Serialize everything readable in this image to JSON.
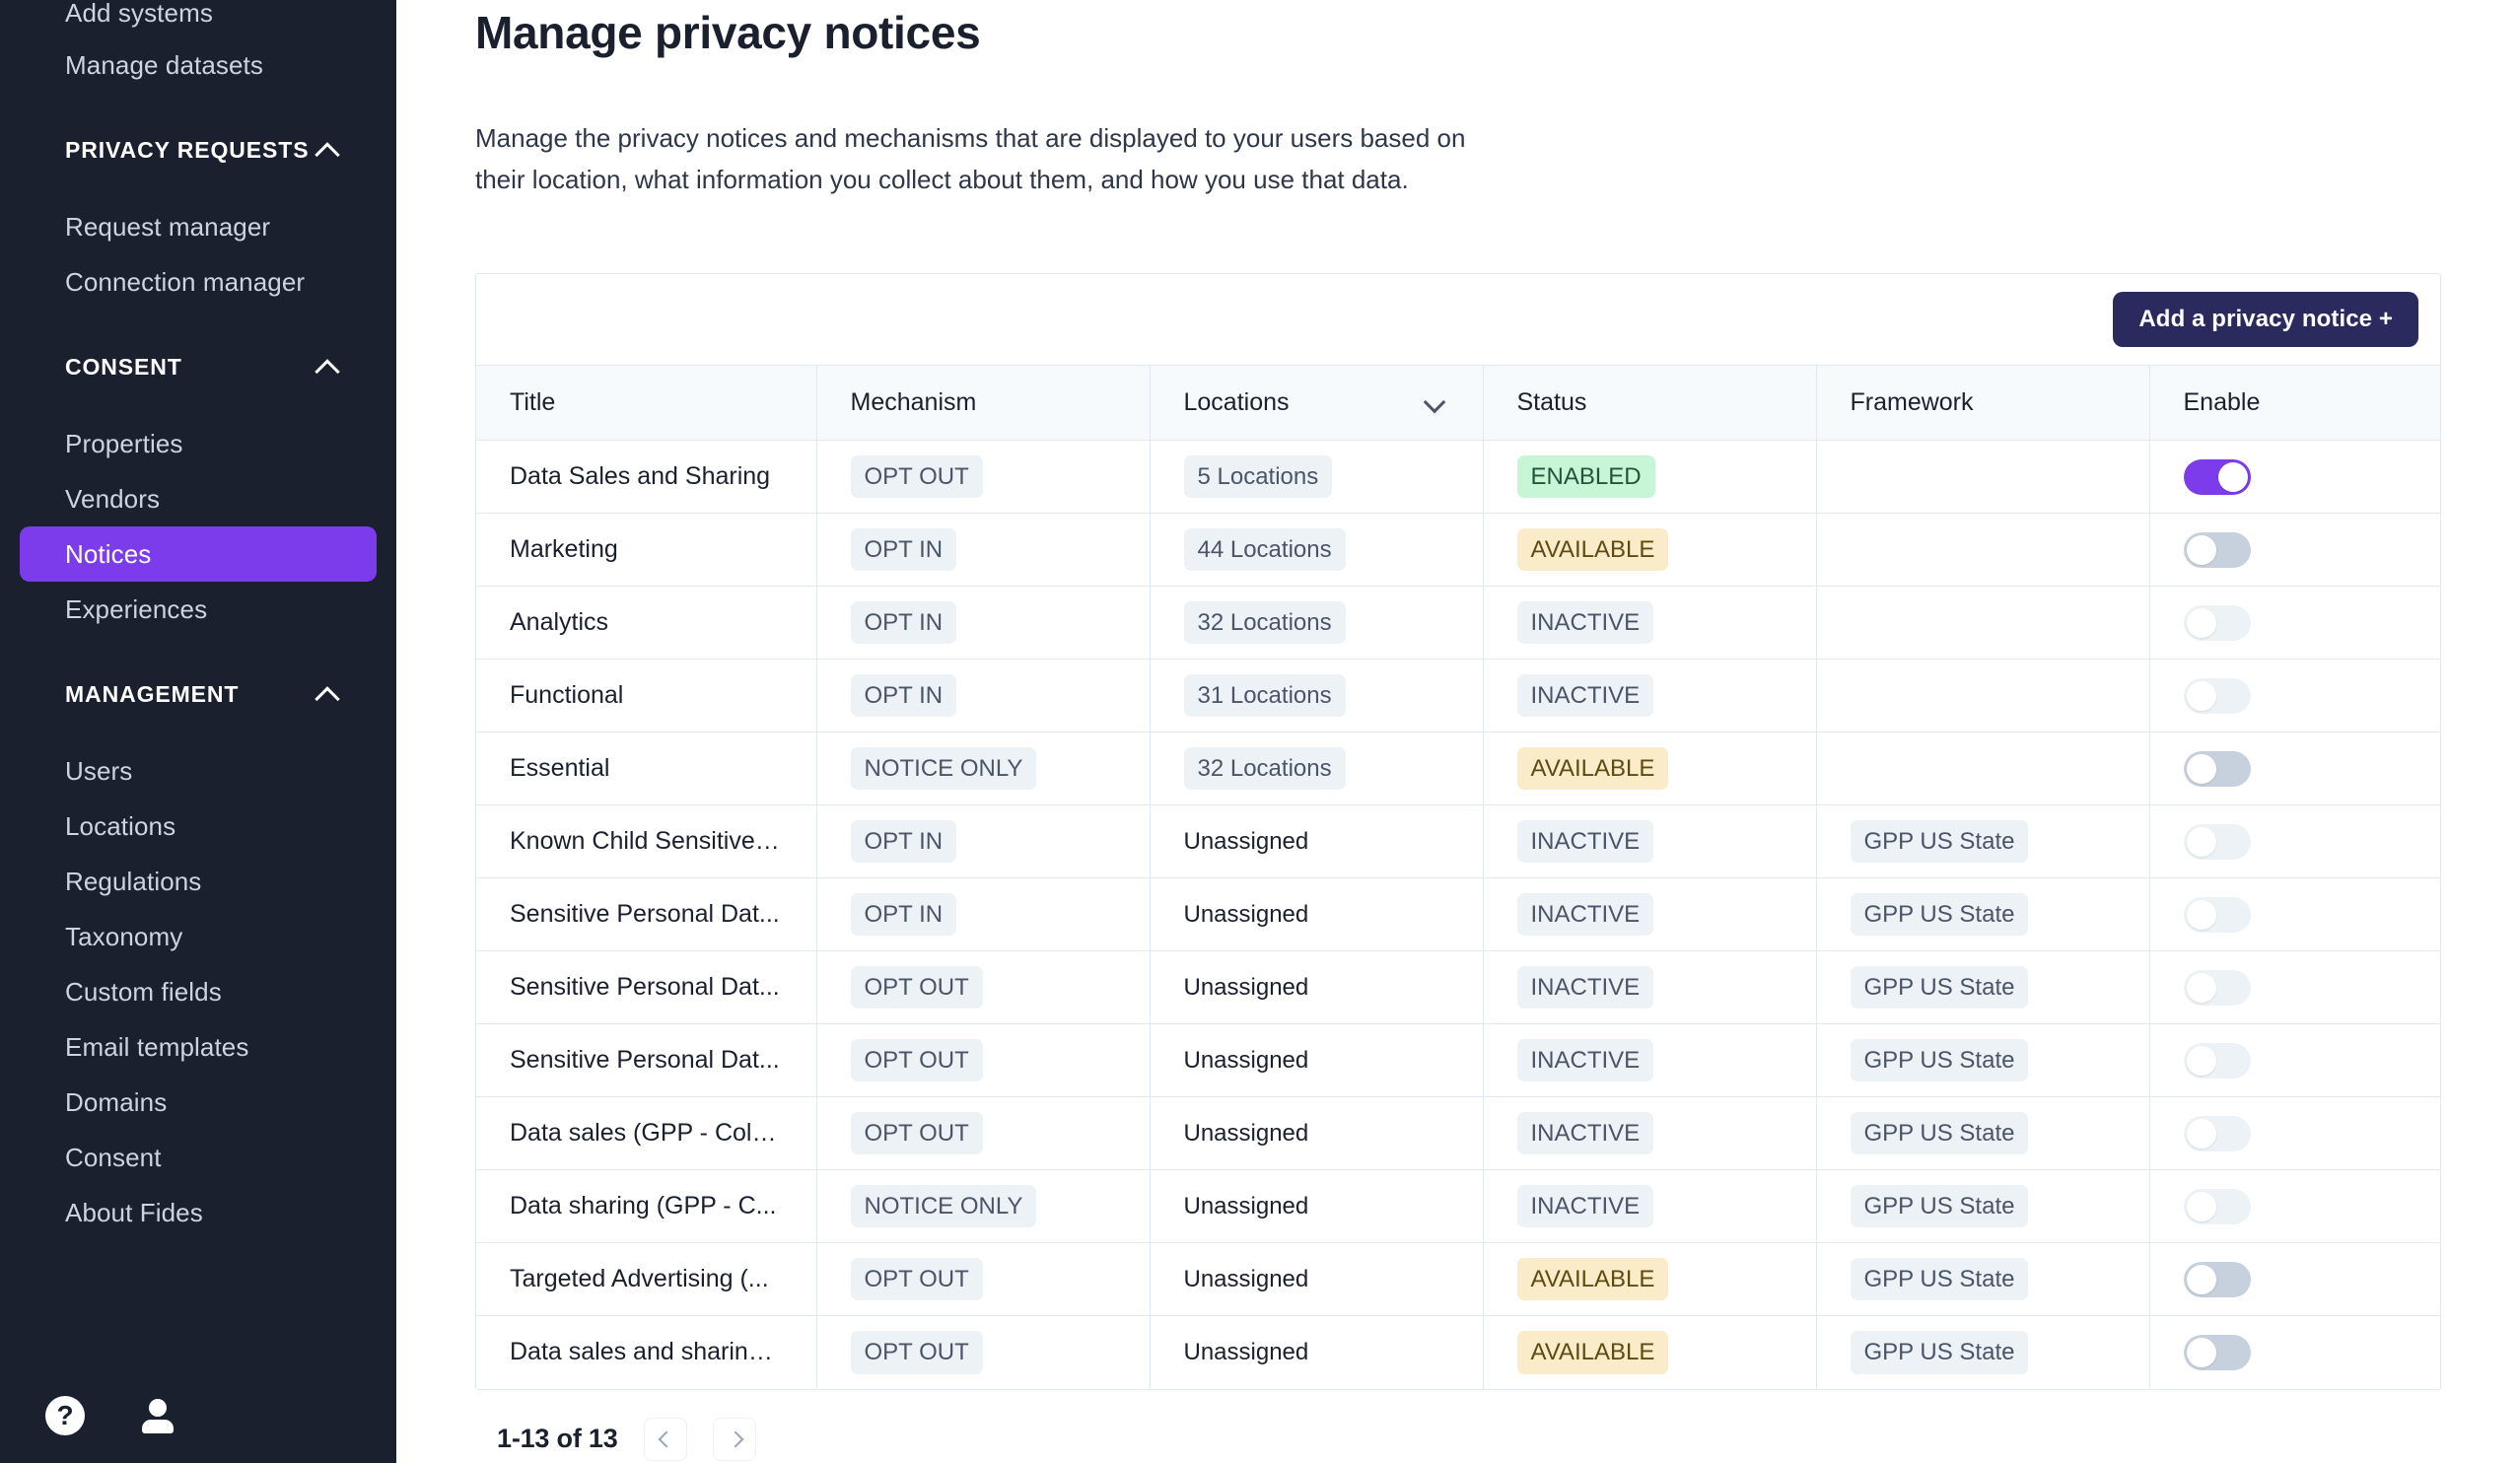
{
  "sidebar": {
    "top_items": [
      {
        "label": "Add systems",
        "active": false,
        "clipped": true
      },
      {
        "label": "Manage datasets",
        "active": false,
        "clipped": false
      }
    ],
    "sections": [
      {
        "title": "PRIVACY REQUESTS",
        "chevron": "chevron-up-icon",
        "items": [
          {
            "label": "Request manager",
            "active": false
          },
          {
            "label": "Connection manager",
            "active": false
          }
        ]
      },
      {
        "title": "CONSENT",
        "chevron": "chevron-up-icon",
        "items": [
          {
            "label": "Properties",
            "active": false
          },
          {
            "label": "Vendors",
            "active": false
          },
          {
            "label": "Notices",
            "active": true
          },
          {
            "label": "Experiences",
            "active": false
          }
        ]
      },
      {
        "title": "MANAGEMENT",
        "chevron": "chevron-up-icon",
        "items": [
          {
            "label": "Users",
            "active": false
          },
          {
            "label": "Locations",
            "active": false
          },
          {
            "label": "Regulations",
            "active": false
          },
          {
            "label": "Taxonomy",
            "active": false
          },
          {
            "label": "Custom fields",
            "active": false
          },
          {
            "label": "Email templates",
            "active": false
          },
          {
            "label": "Domains",
            "active": false
          },
          {
            "label": "Consent",
            "active": false
          },
          {
            "label": "About Fides",
            "active": false
          }
        ]
      }
    ],
    "footer": {
      "help_icon": "help-circle-icon",
      "help_glyph": "?",
      "user_icon": "user-avatar-icon"
    },
    "active_color": "#7C3CEB",
    "background_color": "#1A202E"
  },
  "page": {
    "title": "Manage privacy notices",
    "description": "Manage the privacy notices and mechanisms that are displayed to your users based on their location, what information you collect about them, and how you use that data."
  },
  "toolbar": {
    "add_button_label": "Add a privacy notice +",
    "add_button_color": "#2B2A5E"
  },
  "table": {
    "columns": [
      {
        "key": "title",
        "label": "Title",
        "sortable": false
      },
      {
        "key": "mechanism",
        "label": "Mechanism",
        "sortable": false
      },
      {
        "key": "locations",
        "label": "Locations",
        "sortable": true,
        "icon": "chevron-down-icon"
      },
      {
        "key": "status",
        "label": "Status",
        "sortable": false
      },
      {
        "key": "framework",
        "label": "Framework",
        "sortable": false
      },
      {
        "key": "enable",
        "label": "Enable",
        "sortable": false
      }
    ],
    "rows": [
      {
        "title": "Data Sales and Sharing",
        "mechanism": "OPT OUT",
        "locations": "5 Locations",
        "locations_tag": true,
        "status": "ENABLED",
        "status_kind": "enabled",
        "framework": "",
        "enabled": true,
        "toggle_state": "on"
      },
      {
        "title": "Marketing",
        "mechanism": "OPT IN",
        "locations": "44 Locations",
        "locations_tag": true,
        "status": "AVAILABLE",
        "status_kind": "available",
        "framework": "",
        "enabled": false,
        "toggle_state": "mid"
      },
      {
        "title": "Analytics",
        "mechanism": "OPT IN",
        "locations": "32 Locations",
        "locations_tag": true,
        "status": "INACTIVE",
        "status_kind": "inactive",
        "framework": "",
        "enabled": false,
        "toggle_state": "off"
      },
      {
        "title": "Functional",
        "mechanism": "OPT IN",
        "locations": "31 Locations",
        "locations_tag": true,
        "status": "INACTIVE",
        "status_kind": "inactive",
        "framework": "",
        "enabled": false,
        "toggle_state": "off"
      },
      {
        "title": "Essential",
        "mechanism": "NOTICE ONLY",
        "locations": "32 Locations",
        "locations_tag": true,
        "status": "AVAILABLE",
        "status_kind": "available",
        "framework": "",
        "enabled": false,
        "toggle_state": "mid"
      },
      {
        "title": "Known Child Sensitive ...",
        "mechanism": "OPT IN",
        "locations": "Unassigned",
        "locations_tag": false,
        "status": "INACTIVE",
        "status_kind": "inactive",
        "framework": "GPP US State",
        "enabled": false,
        "toggle_state": "off"
      },
      {
        "title": "Sensitive Personal Dat...",
        "mechanism": "OPT IN",
        "locations": "Unassigned",
        "locations_tag": false,
        "status": "INACTIVE",
        "status_kind": "inactive",
        "framework": "GPP US State",
        "enabled": false,
        "toggle_state": "off"
      },
      {
        "title": "Sensitive Personal Dat...",
        "mechanism": "OPT OUT",
        "locations": "Unassigned",
        "locations_tag": false,
        "status": "INACTIVE",
        "status_kind": "inactive",
        "framework": "GPP US State",
        "enabled": false,
        "toggle_state": "off"
      },
      {
        "title": "Sensitive Personal Dat...",
        "mechanism": "OPT OUT",
        "locations": "Unassigned",
        "locations_tag": false,
        "status": "INACTIVE",
        "status_kind": "inactive",
        "framework": "GPP US State",
        "enabled": false,
        "toggle_state": "off"
      },
      {
        "title": "Data sales (GPP - Colo...",
        "mechanism": "OPT OUT",
        "locations": "Unassigned",
        "locations_tag": false,
        "status": "INACTIVE",
        "status_kind": "inactive",
        "framework": "GPP US State",
        "enabled": false,
        "toggle_state": "off"
      },
      {
        "title": "Data sharing (GPP - C...",
        "mechanism": "NOTICE ONLY",
        "locations": "Unassigned",
        "locations_tag": false,
        "status": "INACTIVE",
        "status_kind": "inactive",
        "framework": "GPP US State",
        "enabled": false,
        "toggle_state": "off"
      },
      {
        "title": "Targeted Advertising (...",
        "mechanism": "OPT OUT",
        "locations": "Unassigned",
        "locations_tag": false,
        "status": "AVAILABLE",
        "status_kind": "available",
        "framework": "GPP US State",
        "enabled": false,
        "toggle_state": "mid"
      },
      {
        "title": "Data sales and sharing...",
        "mechanism": "OPT OUT",
        "locations": "Unassigned",
        "locations_tag": false,
        "status": "AVAILABLE",
        "status_kind": "available",
        "framework": "GPP US State",
        "enabled": false,
        "toggle_state": "mid"
      }
    ]
  },
  "pagination": {
    "range_label": "1-13 of 13",
    "prev_icon": "chevron-left-icon",
    "next_icon": "chevron-right-icon"
  },
  "colors": {
    "accent_purple": "#7C3CEB",
    "button_navy": "#2B2A5E",
    "status_enabled_bg": "#C6F6D5",
    "status_available_bg": "#FAECC8",
    "status_inactive_bg": "#EDF2F7"
  }
}
